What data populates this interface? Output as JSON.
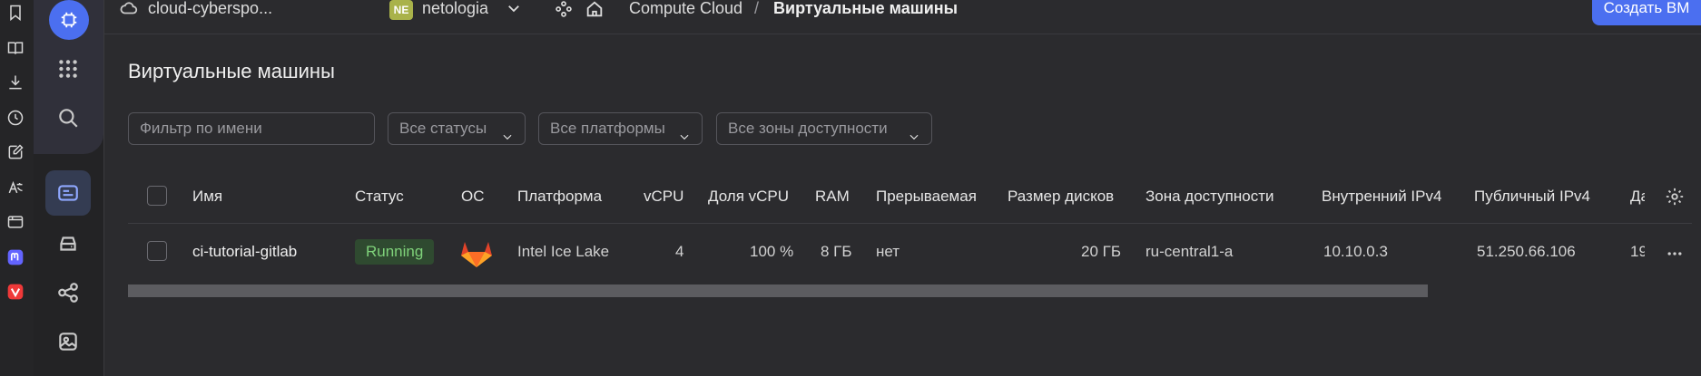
{
  "topbar": {
    "cloud_name": "cloud-cyberspo...",
    "folder_badge": "NE",
    "folder_name": "netologia",
    "service": "Compute Cloud",
    "separator": "/",
    "current_page": "Виртуальные машины",
    "create_button": "Создать ВМ"
  },
  "page": {
    "title": "Виртуальные машины"
  },
  "filters": {
    "name_placeholder": "Фильтр по имени",
    "status": "Все статусы",
    "platform": "Все платформы",
    "zone": "Все зоны доступности"
  },
  "table": {
    "headers": [
      "Имя",
      "Статус",
      "ОС",
      "Платформа",
      "vCPU",
      "Доля vCPU",
      "RAM",
      "Прерываемая",
      "Размер дисков",
      "Зона доступности",
      "Внутренний IPv4",
      "Публичный IPv4",
      "Да"
    ],
    "rows": [
      {
        "name": "ci-tutorial-gitlab",
        "status": "Running",
        "os_icon": "gitlab-icon",
        "platform": "Intel Ice Lake",
        "vcpu": "4",
        "vcpu_share": "100 %",
        "ram": "8 ГБ",
        "preemptible": "нет",
        "disk_size": "20 ГБ",
        "zone": "ru-central1-a",
        "internal_ip": "10.10.0.3",
        "public_ip": "51.250.66.106",
        "date_partial": "19"
      }
    ]
  },
  "colors": {
    "accent": "#4b6ff0",
    "running_bg": "#2f4a30",
    "running_text": "#7fd27a",
    "background": "#2b2b2e"
  }
}
